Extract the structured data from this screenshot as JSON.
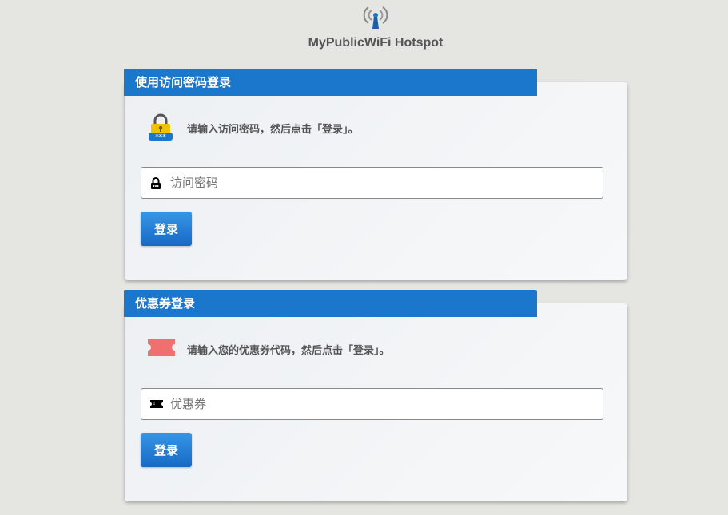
{
  "header": {
    "title": "MyPublicWiFi Hotspot",
    "logo_icon": "wifi-antenna-icon"
  },
  "password_login": {
    "heading": "使用访问密码登录",
    "info_icon": "padlock-icon",
    "info_text": "请输入访问密码，然后点击「登录」。",
    "field_icon": "lock-icon",
    "input_placeholder": "访问密码",
    "input_value": "",
    "button_label": "登录"
  },
  "voucher_login": {
    "heading": "优惠券登录",
    "info_icon": "ticket-icon",
    "info_text": "请输入您的优惠券代码，然后点击「登录」。",
    "field_icon": "ticket-icon",
    "input_placeholder": "优惠券",
    "input_value": "",
    "button_label": "登录"
  },
  "colors": {
    "accent": "#1a77cc",
    "button": "#2a82d8",
    "background": "#e5e5e1",
    "ticket": "#f07070",
    "lock_yellow": "#f2c200"
  }
}
